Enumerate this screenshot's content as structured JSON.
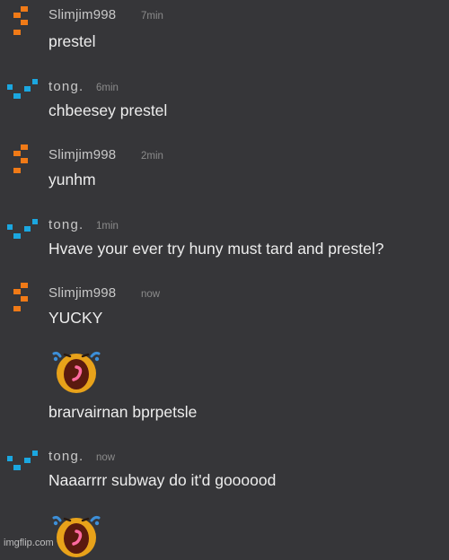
{
  "chat": {
    "messages": [
      {
        "user": "Slimjim998",
        "time": "7min",
        "text": "prestel",
        "avatar_color": "#f07a17"
      },
      {
        "user": "tong.",
        "time": "6min",
        "text": "chbeesey prestel",
        "avatar_color": "#1ba7e0"
      },
      {
        "user": "Slimjim998",
        "time": "2min",
        "text": "yunhm",
        "avatar_color": "#f07a17"
      },
      {
        "user": "tong.",
        "time": "1min",
        "text": "Hvave your ever try huny must tard and prestel?",
        "avatar_color": "#1ba7e0"
      },
      {
        "user": "Slimjim998",
        "time": "now",
        "text": "YUCKY",
        "avatar_color": "#f07a17"
      },
      {
        "user": "",
        "time": "",
        "text": "brarvairnan bprpetsle",
        "sticker": "crying-bread-sticker"
      },
      {
        "user": "tong.",
        "time": "now",
        "text": "Naaarrrr subway do it'd goooood",
        "avatar_color": "#1ba7e0"
      }
    ]
  },
  "watermark": {
    "text": "imgflip.com"
  }
}
